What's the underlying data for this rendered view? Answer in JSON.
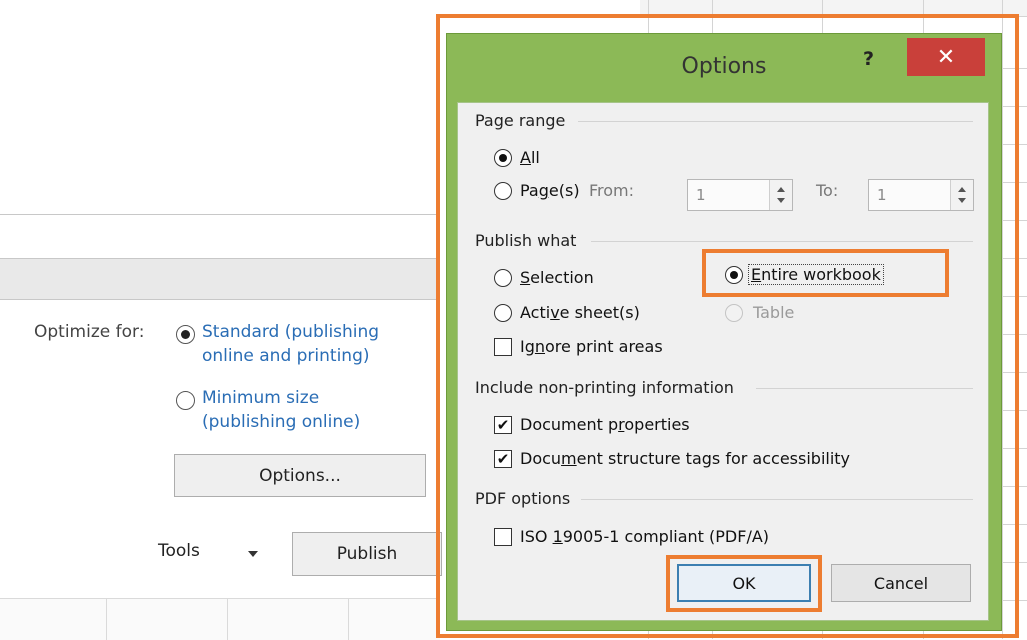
{
  "background": {
    "optimize_label": "Optimize for:",
    "standard_line1": "Standard (publishing",
    "standard_line2": "online and printing)",
    "minimum_line1": "Minimum size",
    "minimum_line2": "(publishing online)",
    "options_button": "Options...",
    "tools_label": "Tools",
    "publish_button": "Publish"
  },
  "dialog": {
    "title": "Options",
    "help_glyph": "?",
    "close_glyph": "✕",
    "page_range": {
      "label": "Page range",
      "all_label": "All",
      "pages_label": "Page(s)",
      "from_label": "From:",
      "from_value": "1",
      "to_label": "To:",
      "to_value": "1"
    },
    "publish_what": {
      "label": "Publish what",
      "selection_label": "Selection",
      "entire_label": "Entire workbook",
      "active_label": "Active sheet(s)",
      "table_label": "Table",
      "ignore_label": "Ignore print areas"
    },
    "nonprinting": {
      "label": "Include non-printing information",
      "doc_props_label": "Document properties",
      "doc_struct_label": "Document structure tags for accessibility"
    },
    "pdf_options": {
      "label": "PDF options",
      "iso_label": "ISO 19005-1 compliant (PDF/A)"
    },
    "ok_label": "OK",
    "cancel_label": "Cancel",
    "checkmark": "✔"
  },
  "colors": {
    "highlight": "#ed7d31",
    "dialog_frame": "#8cb957",
    "close_button": "#c9403a",
    "link": "#2a6db5"
  }
}
